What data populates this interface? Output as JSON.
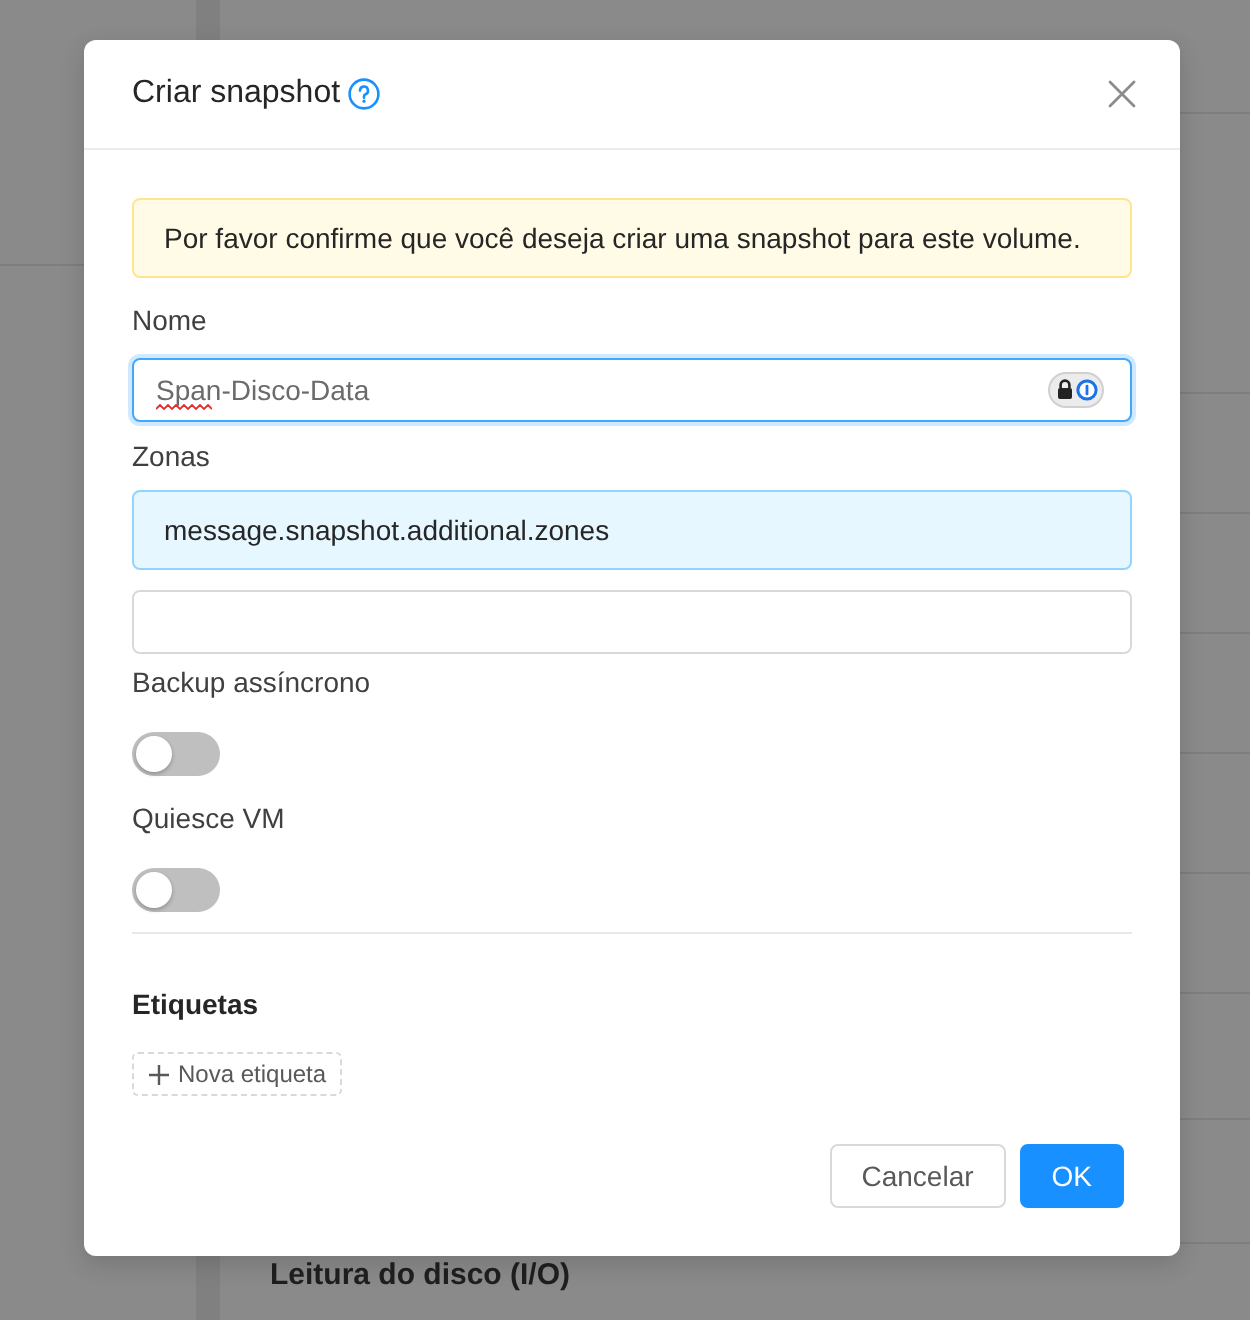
{
  "dialog": {
    "title": "Criar snapshot",
    "alert": "Por favor confirme que você deseja criar uma snapshot para este volume.",
    "fields": [
      {
        "kind": "text",
        "label": "Nome",
        "value": "Span-Disco-Data",
        "focused": true
      },
      {
        "kind": "info",
        "label": "Zonas",
        "text": "message.snapshot.additional.zones"
      },
      {
        "kind": "input",
        "focused": false
      },
      {
        "kind": "switch",
        "label": "Backup assíncrono",
        "on": false
      },
      {
        "kind": "switch",
        "label": "Quiesce VM",
        "on": false
      }
    ],
    "tags": {
      "title": "Etiquetas",
      "add_button": "Nova etiqueta"
    },
    "buttons": [
      {
        "label": "Cancelar",
        "kind": "default"
      },
      {
        "label": "OK",
        "kind": "primary"
      }
    ]
  },
  "background": {
    "section_title": "Leitura do disco (I/O)"
  }
}
